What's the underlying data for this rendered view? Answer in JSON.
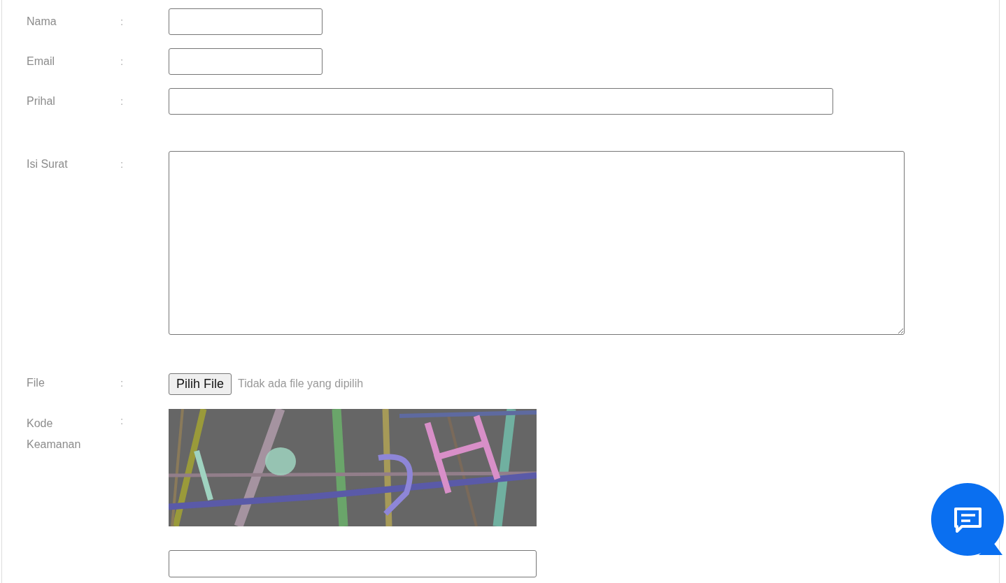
{
  "form": {
    "fields": [
      {
        "kind": "short_text",
        "label": "Nama",
        "separator": ":"
      },
      {
        "kind": "short_text",
        "label": "Email",
        "separator": ":"
      },
      {
        "kind": "long_text",
        "label": "Prihal",
        "separator": ":"
      },
      {
        "kind": "textarea",
        "label": "Isi Surat",
        "separator": ":"
      },
      {
        "kind": "file",
        "label": "File",
        "separator": ":",
        "button": "Pilih File",
        "status": "Tidak ada file yang dipilih"
      },
      {
        "kind": "captcha",
        "label": "Kode Keamanan",
        "separator": ":"
      }
    ]
  },
  "chat_button": {
    "kind": "chat"
  }
}
